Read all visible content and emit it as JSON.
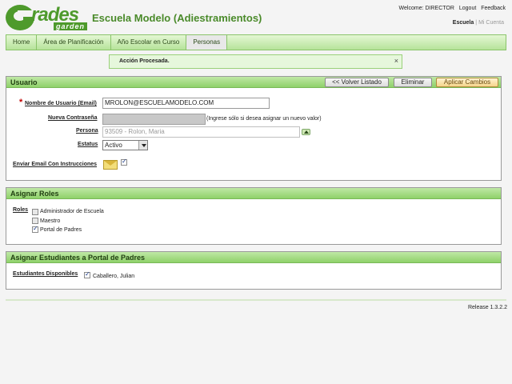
{
  "brand": {
    "logo_main": "rades",
    "logo_sub": "garden",
    "app_title": "Escuela Modelo (Adiestramientos)"
  },
  "top_links": {
    "welcome": "Welcome: DIRECTOR",
    "logout": "Logout",
    "feedback": "Feedback",
    "escuela": "Escuela",
    "separator": "|",
    "mi_cuenta": "Mi Cuenta"
  },
  "nav": {
    "tabs": [
      "Home",
      "Área de Planificación",
      "Año Escolar en Curso",
      "Personas"
    ],
    "active": "Personas"
  },
  "message": {
    "text": "Acción Procesada.",
    "close": "×"
  },
  "usuario": {
    "title": "Usuario",
    "buttons": {
      "back": "<< Volver Listado",
      "delete": "Eliminar",
      "apply": "Aplicar Cambios"
    },
    "fields": {
      "username_label": "Nombre de Usuario (Email)",
      "username_value": "MROLON@ESCUELAMODELO.COM",
      "password_label": "Nueva Contraseña",
      "password_hint": "(Ingrese sólo si desea asignar un nuevo valor)",
      "persona_label": "Persona",
      "persona_value": "93509 - Rolon, Maria",
      "estatus_label": "Estatus",
      "estatus_value": "Activo",
      "email_label": "Enviar Email Con Instrucciones",
      "required_marker": "*"
    }
  },
  "roles": {
    "title": "Asignar Roles",
    "label": "Roles",
    "items": [
      {
        "label": "Administrador de Escuela",
        "checked": false
      },
      {
        "label": "Maestro",
        "checked": false
      },
      {
        "label": "Portal de Padres",
        "checked": true
      }
    ]
  },
  "estudiantes": {
    "title": "Asignar Estudiantes a Portal de Padres",
    "label": "Estudiantes Disponibles",
    "items": [
      {
        "label": "Caballero, Julian",
        "checked": true
      }
    ]
  },
  "footer": {
    "release": "Release 1.3.2.2"
  },
  "colors": {
    "brand_green": "#4e9a2c",
    "panel_header": "#8fd16a",
    "required": "#c00000"
  }
}
